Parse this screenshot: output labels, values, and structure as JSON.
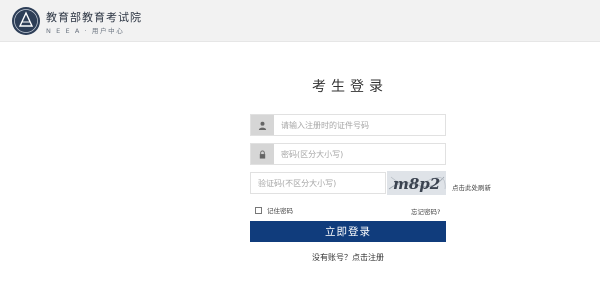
{
  "header": {
    "title": "教育部教育考试院",
    "subtitle": "N E E A · 用户中心",
    "logo_icon": "neea-logo-icon"
  },
  "login": {
    "title": "考生登录",
    "username": {
      "placeholder": "请输入注册时的证件号码",
      "value": "",
      "icon": "user-icon"
    },
    "password": {
      "placeholder": "密码(区分大小写)",
      "value": "",
      "icon": "lock-icon"
    },
    "captcha": {
      "placeholder": "验证码(不区分大小写)",
      "value": "",
      "image_text": "m8p2",
      "refresh_label": "点击此处刷新"
    },
    "remember_label": "记住密码",
    "remember_checked": false,
    "forgot_label": "忘记密码?",
    "submit_label": "立即登录",
    "register_label": "没有账号？点击注册"
  },
  "colors": {
    "primary_button": "#103c7c",
    "header_bg": "#f2f2f2",
    "icon_box": "#d6d6d6"
  }
}
